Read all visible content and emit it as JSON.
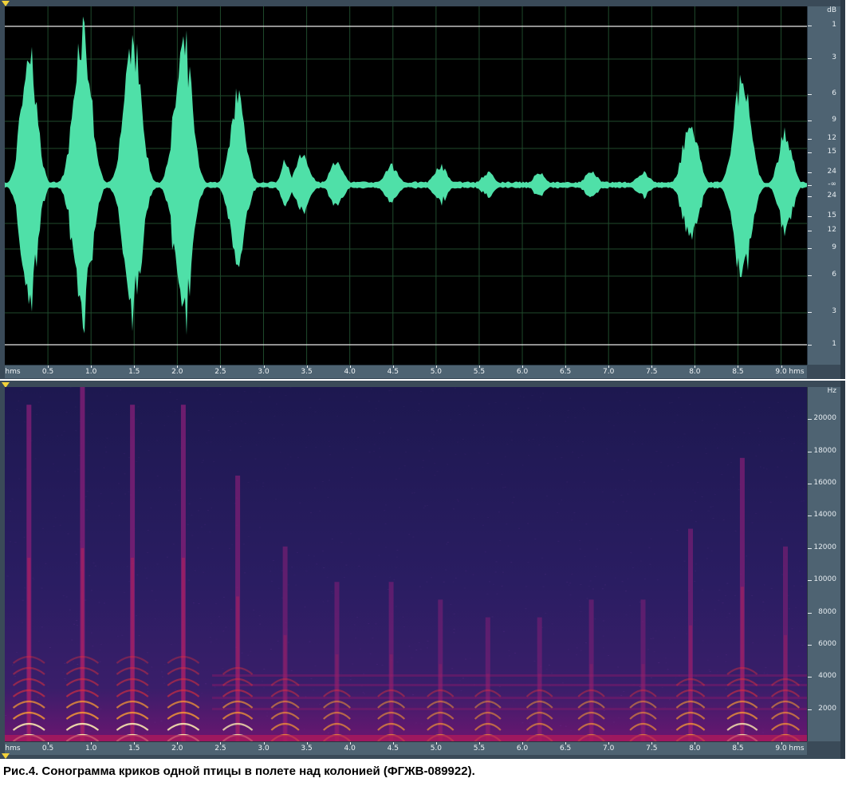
{
  "waveform": {
    "db_unit": "dB",
    "db_labels_top": [
      "1",
      "3",
      "6",
      "9",
      "12",
      "15",
      "24"
    ],
    "center_label": "-∞",
    "db_labels_bottom": [
      "24",
      "15",
      "12",
      "9",
      "6",
      "3",
      "1"
    ],
    "wave_color": "#4fe0a8",
    "bursts": [
      {
        "t": 0.28,
        "amp": 0.88,
        "w": 0.18
      },
      {
        "t": 0.9,
        "amp": 1.0,
        "w": 0.2
      },
      {
        "t": 1.48,
        "amp": 0.95,
        "w": 0.2
      },
      {
        "t": 2.07,
        "amp": 0.92,
        "w": 0.2
      },
      {
        "t": 2.7,
        "amp": 0.55,
        "w": 0.18
      },
      {
        "t": 3.25,
        "amp": 0.15,
        "w": 0.1
      },
      {
        "t": 3.45,
        "amp": 0.2,
        "w": 0.16
      },
      {
        "t": 3.85,
        "amp": 0.15,
        "w": 0.16
      },
      {
        "t": 4.48,
        "amp": 0.12,
        "w": 0.16
      },
      {
        "t": 5.05,
        "amp": 0.12,
        "w": 0.16
      },
      {
        "t": 5.6,
        "amp": 0.08,
        "w": 0.14
      },
      {
        "t": 6.2,
        "amp": 0.08,
        "w": 0.14
      },
      {
        "t": 6.8,
        "amp": 0.08,
        "w": 0.16
      },
      {
        "t": 7.4,
        "amp": 0.08,
        "w": 0.16
      },
      {
        "t": 7.95,
        "amp": 0.4,
        "w": 0.18
      },
      {
        "t": 8.55,
        "amp": 0.65,
        "w": 0.2
      },
      {
        "t": 9.05,
        "amp": 0.32,
        "w": 0.16
      }
    ]
  },
  "spectrogram": {
    "hz_unit": "Hz",
    "hz_labels": [
      "20000",
      "18000",
      "16000",
      "14000",
      "12000",
      "10000",
      "8000",
      "6000",
      "4000",
      "2000"
    ],
    "max_hz": 22000,
    "call_times": [
      0.28,
      0.9,
      1.48,
      2.07,
      2.7,
      3.25,
      3.85,
      4.48,
      5.05,
      5.6,
      6.2,
      6.8,
      7.4,
      7.95,
      8.55,
      9.05
    ],
    "call_strengths": [
      0.95,
      1.0,
      0.95,
      0.95,
      0.75,
      0.55,
      0.45,
      0.45,
      0.4,
      0.35,
      0.35,
      0.4,
      0.4,
      0.6,
      0.8,
      0.55
    ],
    "background_color": "#1e1752"
  },
  "time_axis": {
    "unit_left": "hms",
    "unit_right": "hms",
    "labels": [
      "0.5",
      "1.0",
      "1.5",
      "2.0",
      "2.5",
      "3.0",
      "3.5",
      "4.0",
      "4.5",
      "5.0",
      "5.5",
      "6.0",
      "6.5",
      "7.0",
      "7.5",
      "8.0",
      "8.5",
      "9.0"
    ],
    "duration_s": 9.3
  },
  "caption": "Рис.4. Сонограмма криков одной птицы в полете над колонией (ФГЖВ-089922)."
}
